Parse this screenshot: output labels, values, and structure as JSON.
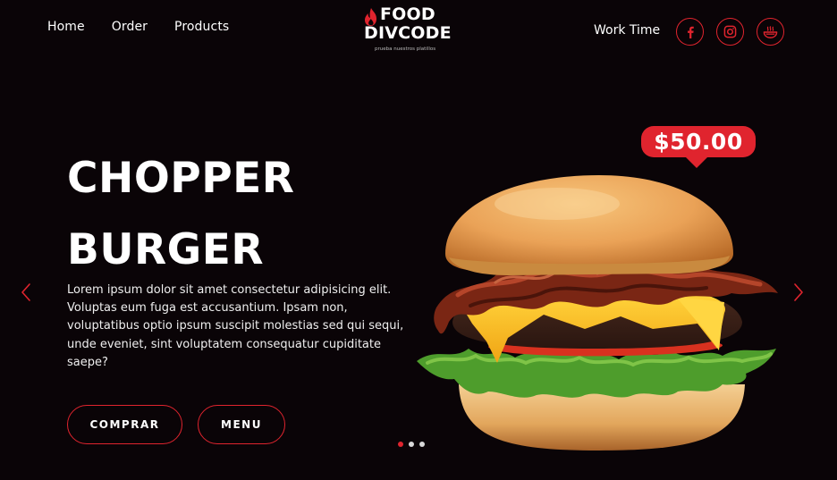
{
  "nav": {
    "items": [
      "Home",
      "Order",
      "Products"
    ]
  },
  "logo": {
    "line1": "FOOD",
    "line2": "DIVCODE",
    "tagline": "prueba nuestros platillos"
  },
  "header": {
    "work_time": "Work Time"
  },
  "social": {
    "icons": [
      "facebook-icon",
      "instagram-icon",
      "bowl-icon"
    ]
  },
  "hero": {
    "title_line1": "CHOPPER",
    "title_line2": "BURGER",
    "description": "Lorem ipsum dolor sit amet consectetur adipisicing elit. Voluptas eum fuga est accusantium. Ipsam non, voluptatibus optio ipsum suscipit molestias sed qui sequi, unde eveniet, sint voluptatem consequatur cupiditate saepe?",
    "buy_label": "COMPRAR",
    "menu_label": "MENU",
    "price": "$50.00"
  },
  "slider": {
    "slide_count": 3,
    "active_index": 0
  },
  "colors": {
    "accent": "#e0242e",
    "background": "#0a0407",
    "text": "#ffffff"
  }
}
